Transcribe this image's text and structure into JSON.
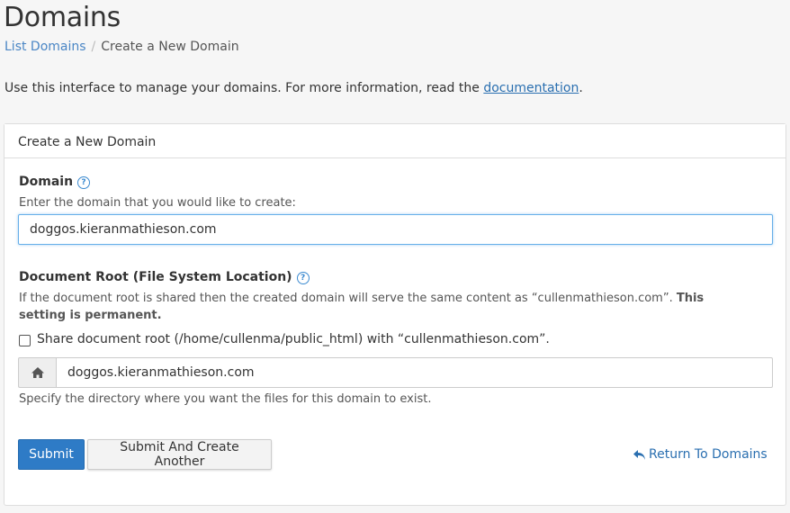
{
  "header": {
    "title": "Domains",
    "breadcrumb": {
      "link": "List Domains",
      "separator": "/",
      "current": "Create a New Domain"
    },
    "intro_text": "Use this interface to manage your domains. For more information, read the ",
    "intro_link": "documentation",
    "intro_end": "."
  },
  "panel": {
    "heading": "Create a New Domain",
    "domain": {
      "label": "Domain",
      "hint": "Enter the domain that you would like to create:",
      "value": "doggos.kieranmathieson.com"
    },
    "docroot": {
      "label": "Document Root (File System Location)",
      "info_text": "If the document root is shared then the created domain will serve the same content as “cullenmathieson.com”. ",
      "info_bold": "This setting is permanent.",
      "share_label": "Share document root (/home/cullenma/public_html) with “cullenmathieson.com”.",
      "share_checked": false,
      "value": "doggos.kieranmathieson.com",
      "hint": "Specify the directory where you want the files for this domain to exist."
    },
    "buttons": {
      "submit": "Submit",
      "submit_another": "Submit And Create Another",
      "return": "Return To Domains"
    }
  },
  "colors": {
    "primary": "#2e7bc6",
    "link": "#2a6fb0",
    "help_icon": "#3b8ad0"
  },
  "icons": {
    "help": "question-circle-icon",
    "home": "home-icon",
    "return": "reply-arrow-icon"
  }
}
